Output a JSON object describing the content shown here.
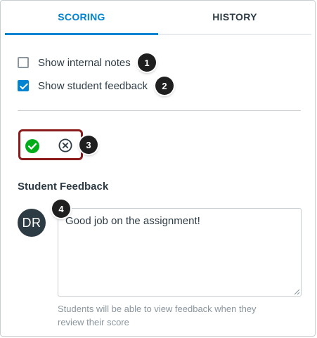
{
  "tabs": [
    {
      "label": "SCORING",
      "active": true
    },
    {
      "label": "HISTORY",
      "active": false
    }
  ],
  "options": {
    "internal_notes": {
      "label": "Show internal notes",
      "checked": false
    },
    "student_feedback": {
      "label": "Show student feedback",
      "checked": true
    }
  },
  "callouts": [
    "1",
    "2",
    "3",
    "4"
  ],
  "score_icons": {
    "check": {
      "icon": "check-circle-icon",
      "color": "#00ac18"
    },
    "x": {
      "icon": "x-circle-icon",
      "color": "#2d3b45"
    }
  },
  "feedback": {
    "title": "Student Feedback",
    "avatar_initials": "DR",
    "text": "Good job on the assignment!",
    "hint": "Students will be able to view feedback when they review their score"
  },
  "colors": {
    "accent": "#0084d1",
    "highlight": "#8b1a1a",
    "text": "#2d3b45",
    "muted": "#8b969e"
  }
}
